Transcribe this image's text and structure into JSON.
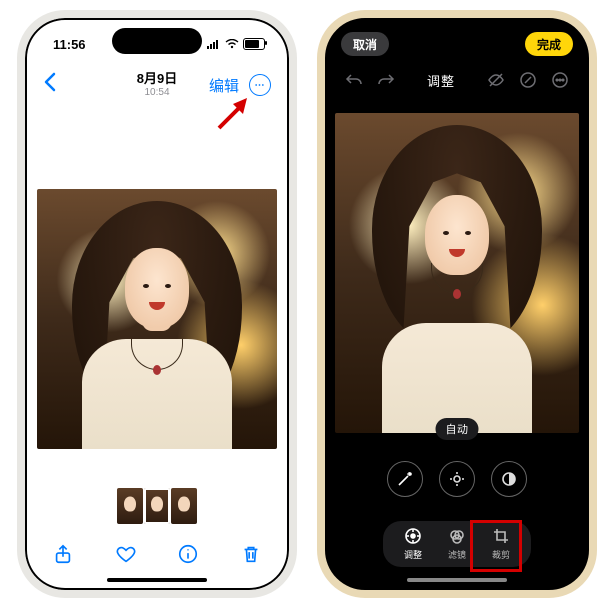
{
  "left": {
    "status": {
      "time": "11:56"
    },
    "nav": {
      "date": "8月9日",
      "time": "10:54",
      "edit": "编辑"
    },
    "toolbar": {
      "share": "share-icon",
      "favorite": "heart-icon",
      "info": "info-icon",
      "delete": "trash-icon"
    }
  },
  "right": {
    "top": {
      "cancel": "取消",
      "done": "完成"
    },
    "mode_title": "调整",
    "auto_label": "自动",
    "tabs": {
      "adjust": "调整",
      "filters": "滤镜",
      "crop": "裁剪"
    }
  },
  "colors": {
    "ios_blue": "#007aff",
    "highlight_red": "#d40000",
    "yellow": "#ffd60a"
  }
}
